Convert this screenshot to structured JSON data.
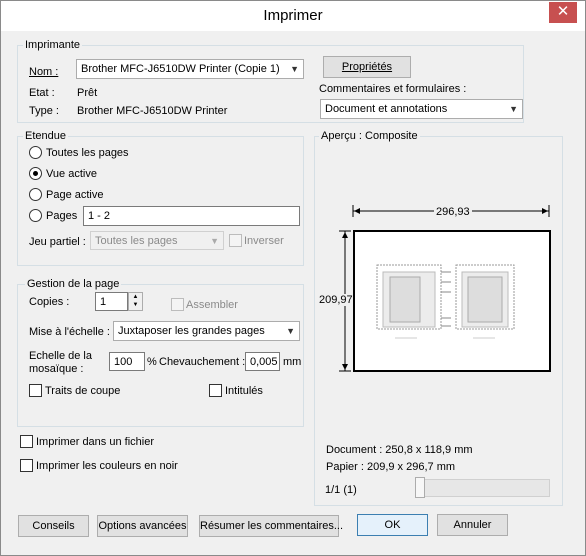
{
  "window": {
    "title": "Imprimer",
    "close": "✕"
  },
  "printer": {
    "group_title": "Imprimante",
    "name_label": "Nom :",
    "name_value": "Brother MFC-J6510DW Printer (Copie 1)",
    "state_label": "Etat :",
    "state_value": "Prêt",
    "type_label": "Type :",
    "type_value": "Brother MFC-J6510DW Printer",
    "properties_button": "Propriétés",
    "comments_label": "Commentaires et formulaires :",
    "comments_value": "Document et annotations"
  },
  "range": {
    "group_title": "Etendue",
    "all_pages": "Toutes les pages",
    "current_view": "Vue active",
    "current_page": "Page active",
    "pages": "Pages",
    "pages_value": "1 - 2",
    "subset_label": "Jeu partiel :",
    "subset_value": "Toutes les pages",
    "reverse": "Inverser",
    "selected": "current_view"
  },
  "page_handling": {
    "group_title": "Gestion de la page",
    "copies_label": "Copies :",
    "copies_value": "1",
    "collate": "Assembler",
    "scaling_label": "Mise à l'échelle :",
    "scaling_value": "Juxtaposer les grandes pages",
    "tile_scale_label_1": "Echelle de la",
    "tile_scale_label_2": "mosaïque :",
    "tile_scale_value": "100",
    "percent": "%",
    "overlap_label": "Chevauchement :",
    "overlap_value": "0,005",
    "overlap_unit": "mm",
    "cut_marks": "Traits de coupe",
    "labels": "Intitulés"
  },
  "print_to_file": "Imprimer dans un fichier",
  "print_black": "Imprimer les couleurs en noir",
  "preview": {
    "group_title": "Aperçu : Composite",
    "width": "296,93",
    "height": "209,97",
    "document_size": "Document : 250,8 x 118,9 mm",
    "paper_size": "Papier : 209,9 x 296,7 mm",
    "page_indicator": "1/1 (1)",
    "slider_position": 0
  },
  "buttons": {
    "tips": "Conseils",
    "advanced": "Options avancées",
    "summarize": "Résumer les commentaires...",
    "ok": "OK",
    "cancel": "Annuler"
  },
  "icons": {
    "radio": "radio",
    "check": "checkbox",
    "dropdown": "chevron-down-icon"
  }
}
